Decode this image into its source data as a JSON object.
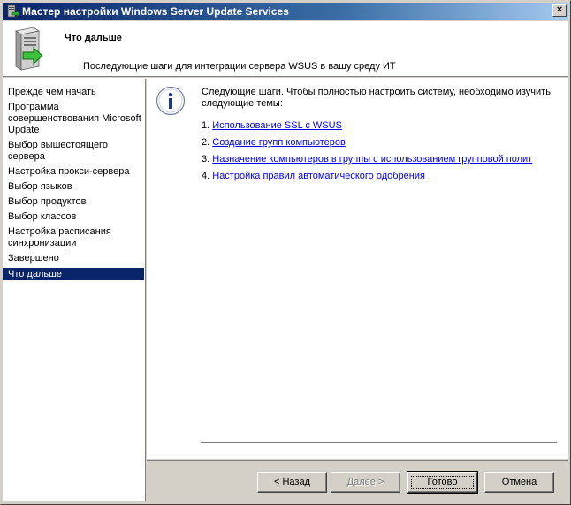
{
  "window": {
    "title": "Мастер настройки Windows Server Update Services",
    "close_label": "×"
  },
  "header": {
    "title": "Что дальше",
    "subtitle": "Последующие шаги для интеграции сервера WSUS в вашу среду ИТ"
  },
  "steps": [
    {
      "label": "Прежде чем начать",
      "active": false
    },
    {
      "label": "Программа совершенствования Microsoft Update",
      "active": false
    },
    {
      "label": "Выбор вышестоящего сервера",
      "active": false
    },
    {
      "label": "Настройка прокси-сервера",
      "active": false
    },
    {
      "label": "Выбор языков",
      "active": false
    },
    {
      "label": "Выбор продуктов",
      "active": false
    },
    {
      "label": "Выбор классов",
      "active": false
    },
    {
      "label": "Настройка расписания синхронизации",
      "active": false
    },
    {
      "label": "Завершено",
      "active": false
    },
    {
      "label": "Что дальше",
      "active": true
    }
  ],
  "content": {
    "intro": "Следующие шаги. Чтобы полностью настроить систему, необходимо изучить следующие темы:",
    "links": [
      {
        "num": "1.",
        "text": "Использование SSL с WSUS"
      },
      {
        "num": "2.",
        "text": "Создание групп компьютеров"
      },
      {
        "num": "3.",
        "text": "Назначение компьютеров в группы с использованием групповой полит"
      },
      {
        "num": "4.",
        "text": "Настройка правил автоматического одобрения"
      }
    ]
  },
  "buttons": {
    "back": "< Назад",
    "next": "Далее >",
    "finish": "Готово",
    "cancel": "Отмена"
  },
  "colors": {
    "title_bar": "#0a246a",
    "selection": "#0a246a",
    "link": "#0000ee",
    "face": "#d4d0c8"
  }
}
